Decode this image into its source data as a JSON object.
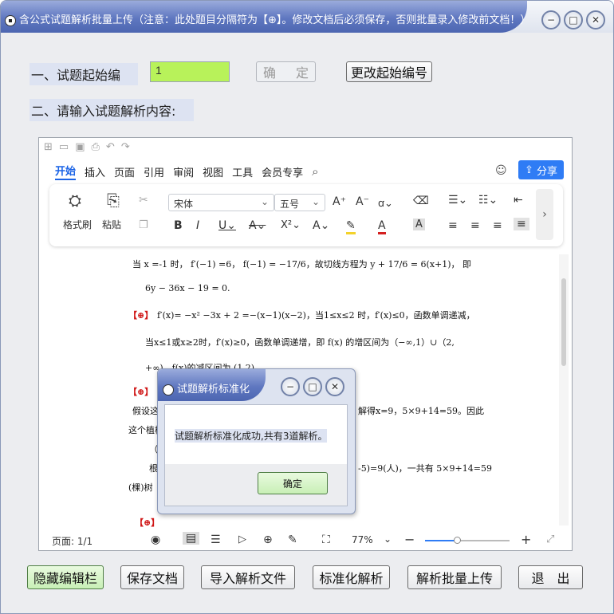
{
  "window": {
    "title": "含公式试题解析批量上传（注意：此处题目分隔符为【⊕】。修改文档后必须保存，否则批量录入修改前文档！）",
    "controls": {
      "minimize": "−",
      "maximize": "□",
      "close": "✕"
    }
  },
  "form": {
    "start_label": "一、试题起始编",
    "start_value": "1",
    "confirm_label": "确 定",
    "change_start_label": "更改起始编号",
    "content_label": "二、请输入试题解析内容:"
  },
  "editor": {
    "menu_tabs": [
      "开始",
      "插入",
      "页面",
      "引用",
      "审阅",
      "视图",
      "工具",
      "会员专享"
    ],
    "share_label": "分享",
    "ribbon": {
      "format_painter": "格式刷",
      "paste": "粘贴",
      "font_name": "宋体",
      "font_size": "五号"
    },
    "status": {
      "page": "页面: 1/1",
      "zoom": "77%"
    },
    "document": {
      "line1": "当 x =-1 时， f′(−1) =6， f(−1) = −17/6，故切线方程为 y + 17/6 = 6(x+1)， 即",
      "line2": "6y − 36x − 19 = 0.",
      "mark1": "【⊕】",
      "line3": "f′(x)= −x² −3x + 2 =−(x−1)(x−2)，当1≤x≤2 时，f′(x)≤0，函数单调递减，",
      "line4": "当x≤1或x≥2时，f′(x)≥0，函数单调递增，即 f(x) 的增区间为（−∞,1）∪（2,",
      "line5": "+∞)，f(x)的减区间为 (1,2)。",
      "mark2": "【⊕】",
      "line6a": "假设这",
      "line6b": "解得x=9，5×9+14=59。因此",
      "line7": "这个植树",
      "line8a": "（",
      "line9a": "根",
      "line9b": "-5)=9(人)，一共有 5×9+14=59",
      "line10": "(棵)树",
      "mark3": "【⊕】"
    }
  },
  "dialog": {
    "title": "试题解析标准化",
    "message": "试题解析标准化成功,共有3道解析。",
    "ok_label": "确定",
    "controls": {
      "minimize": "−",
      "maximize": "□",
      "close": "✕"
    }
  },
  "bottom_buttons": {
    "hide_toolbar": "隐藏编辑栏",
    "save_doc": "保存文档",
    "import_file": "导入解析文件",
    "standardize": "标准化解析",
    "batch_upload": "解析批量上传",
    "exit": "退　出"
  }
}
